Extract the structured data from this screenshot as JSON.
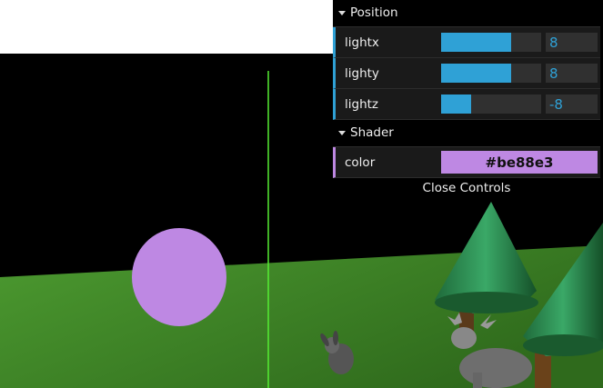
{
  "gui": {
    "folders": [
      {
        "title": "Position",
        "controls": [
          {
            "label": "lightx",
            "value": "8",
            "fill": 0.7
          },
          {
            "label": "lighty",
            "value": "8",
            "fill": 0.7
          },
          {
            "label": "lightz",
            "value": "-8",
            "fill": 0.3
          }
        ]
      },
      {
        "title": "Shader",
        "controls": [
          {
            "label": "color",
            "value": "#be88e3"
          }
        ]
      }
    ],
    "close_label": "Close Controls"
  },
  "colors": {
    "accent": "#2fa1d6",
    "shader_color": "#be88e3",
    "ground": "#3a7d22"
  },
  "scene": {
    "objects": [
      "ground-plane",
      "light-sphere",
      "light-guide-line",
      "tree-1",
      "tree-2",
      "bunny",
      "deer"
    ]
  }
}
